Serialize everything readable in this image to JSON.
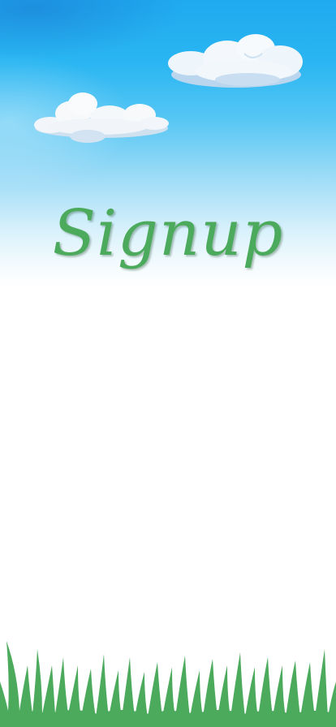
{
  "screen": {
    "title": "Signup"
  },
  "colors": {
    "sky_top": "#1fa9ef",
    "sky_bottom": "#ffffff",
    "title_green": "#4caa5d",
    "grass_green": "#4caa5d",
    "cloud_white": "#f2f7fc",
    "cloud_shadow": "#b9d6ee"
  },
  "icons": {
    "cloud_right": "cloud-icon",
    "cloud_left": "cloud-icon",
    "grass": "grass-decoration"
  }
}
